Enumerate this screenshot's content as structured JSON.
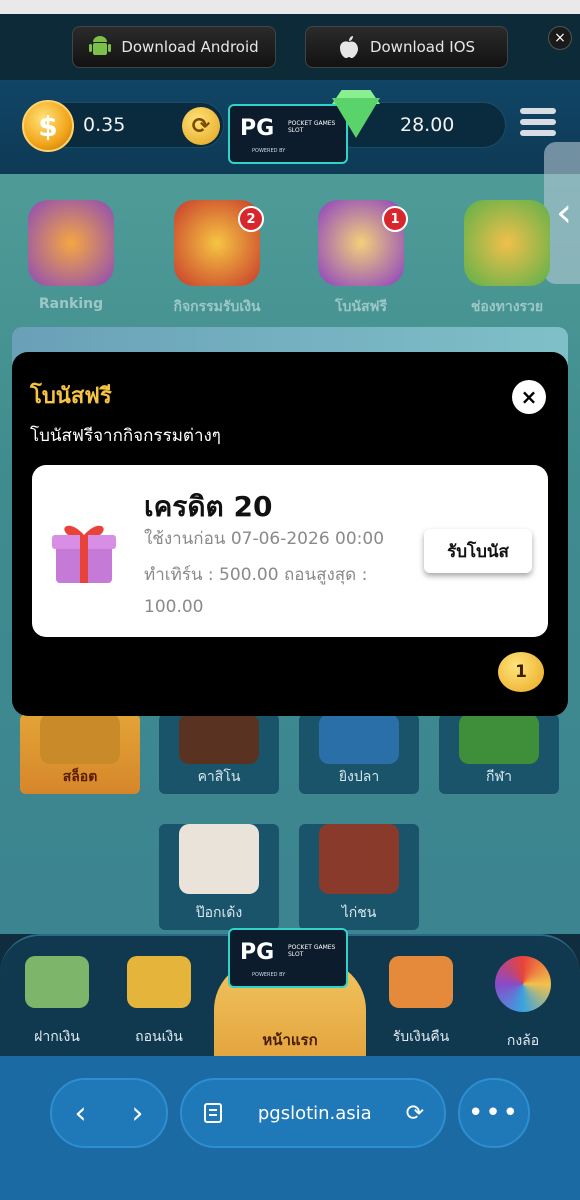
{
  "download_bar": {
    "android_label": "Download Android",
    "ios_label": "Download IOS",
    "close_icon": "×"
  },
  "header": {
    "balance": "0.35",
    "credit": "28.00",
    "logo_text": "PG",
    "logo_sub": "POCKET GAMES SLOT",
    "logo_powered": "POWERED BY"
  },
  "quick_actions": [
    {
      "label": "Ranking",
      "badge": ""
    },
    {
      "label": "กิจกรรมรับเงิน",
      "badge": "2"
    },
    {
      "label": "โบนัสฟรี",
      "badge": "1"
    },
    {
      "label": "ช่องทางรวย",
      "badge": ""
    }
  ],
  "categories": [
    {
      "label": "สล็อต"
    },
    {
      "label": "คาสิโน"
    },
    {
      "label": "ยิงปลา"
    },
    {
      "label": "กีฬา"
    },
    {
      "label": "ป๊อกเด้ง"
    },
    {
      "label": "ไก่ชน"
    }
  ],
  "bottom_nav": [
    {
      "label": "ฝากเงิน"
    },
    {
      "label": "ถอนเงิน"
    },
    {
      "label": "หน้าแรก"
    },
    {
      "label": "รับเงินคืน"
    },
    {
      "label": "กงล้อ"
    }
  ],
  "modal": {
    "title": "โบนัสฟรี",
    "subtitle": "โบนัสฟรีจากกิจกรรมต่างๆ",
    "close": "×",
    "card": {
      "title": "เครดิต 20",
      "expiry": "ใช้งานก่อน 07-06-2026 00:00",
      "turnover": "ทำเทิร์น : 500.00 ถอนสูงสุด :",
      "max_withdraw": "100.00",
      "claim_label": "รับโบนัส"
    },
    "page_badge": "1"
  },
  "browser": {
    "url": "pgslotin.asia",
    "back_icon": "‹",
    "forward_icon": "›",
    "more_icon": "•••"
  },
  "colors": {
    "accent_gold": "#f5c443",
    "header_bg": "#104566",
    "browser_bg": "#1c6aa4"
  }
}
